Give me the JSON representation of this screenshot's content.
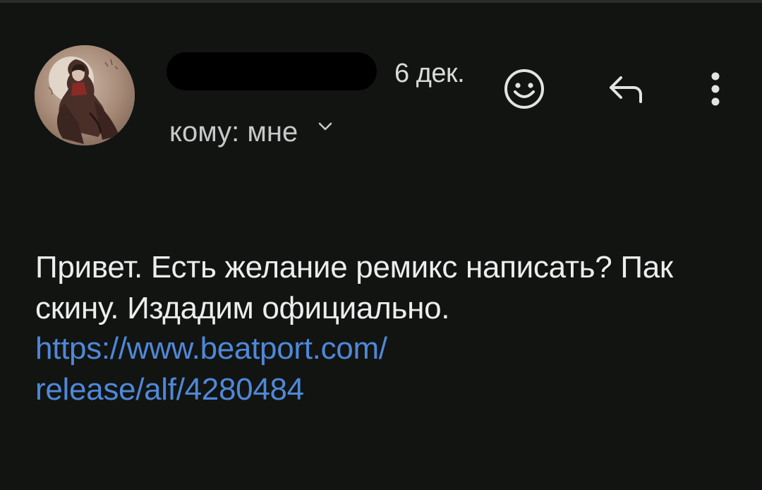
{
  "header": {
    "date": "6 дек.",
    "recipient": "кому: мне"
  },
  "icons": {
    "emoji": "smiley-face-icon",
    "reply": "reply-arrow-icon",
    "more": "more-vertical-icon",
    "expand": "chevron-down-icon"
  },
  "message": {
    "body": "Привет. Есть желание ремикс написать? Пак скину. Издадим официально.",
    "link_line1": "https://www.beatport.com/",
    "link_line2": "release/alf/4280484"
  },
  "colors": {
    "background": "#121412",
    "text": "#eceded",
    "link": "#4f88d8",
    "redaction": "#000000"
  }
}
